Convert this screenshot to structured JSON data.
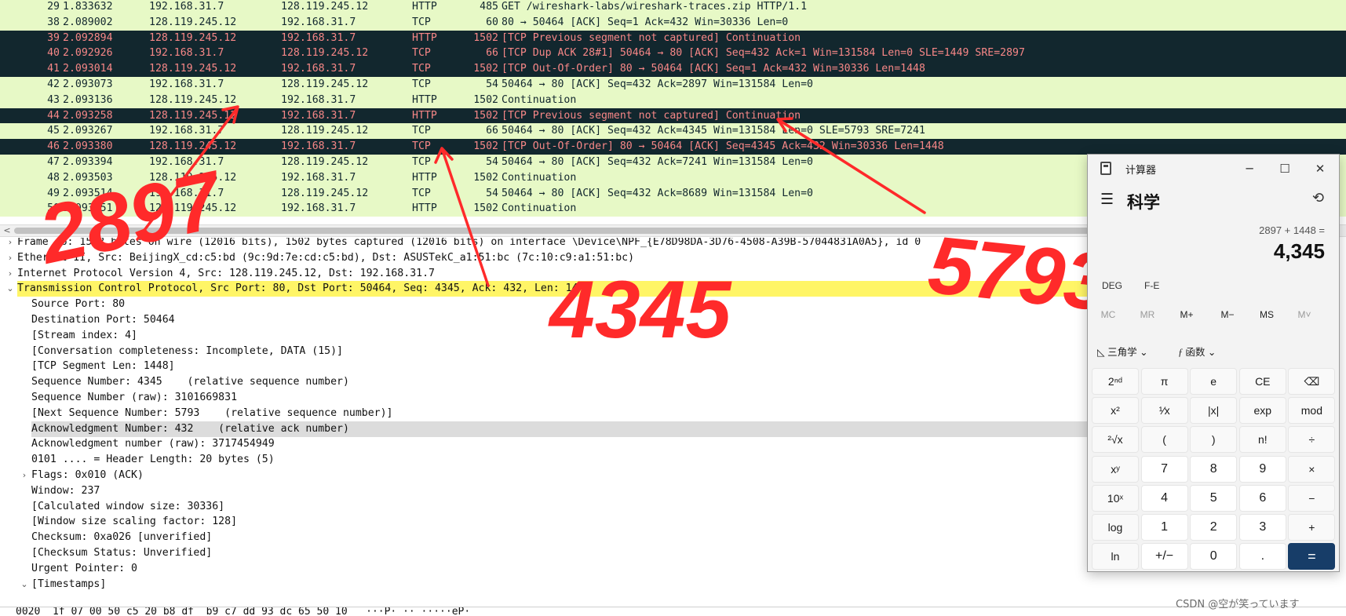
{
  "packets": [
    {
      "no": "29",
      "time": "1.833632",
      "src": "192.168.31.7",
      "dst": "128.119.245.12",
      "proto": "HTTP",
      "len": "485",
      "info": "GET /wireshark-labs/wireshark-traces.zip HTTP/1.1",
      "style": "light"
    },
    {
      "no": "38",
      "time": "2.089002",
      "src": "128.119.245.12",
      "dst": "192.168.31.7",
      "proto": "TCP",
      "len": "60",
      "info": "80 → 50464 [ACK] Seq=1 Ack=432 Win=30336 Len=0",
      "style": "light"
    },
    {
      "no": "39",
      "time": "2.092894",
      "src": "128.119.245.12",
      "dst": "192.168.31.7",
      "proto": "HTTP",
      "len": "1502",
      "info": "[TCP Previous segment not captured] Continuation",
      "style": "dark"
    },
    {
      "no": "40",
      "time": "2.092926",
      "src": "192.168.31.7",
      "dst": "128.119.245.12",
      "proto": "TCP",
      "len": "66",
      "info": "[TCP Dup ACK 28#1] 50464 → 80 [ACK] Seq=432 Ack=1 Win=131584 Len=0 SLE=1449 SRE=2897",
      "style": "dark"
    },
    {
      "no": "41",
      "time": "2.093014",
      "src": "128.119.245.12",
      "dst": "192.168.31.7",
      "proto": "TCP",
      "len": "1502",
      "info": "[TCP Out-Of-Order] 80 → 50464 [ACK] Seq=1 Ack=432 Win=30336 Len=1448",
      "style": "dark"
    },
    {
      "no": "42",
      "time": "2.093073",
      "src": "192.168.31.7",
      "dst": "128.119.245.12",
      "proto": "TCP",
      "len": "54",
      "info": "50464 → 80 [ACK] Seq=432 Ack=2897 Win=131584 Len=0",
      "style": "light"
    },
    {
      "no": "43",
      "time": "2.093136",
      "src": "128.119.245.12",
      "dst": "192.168.31.7",
      "proto": "HTTP",
      "len": "1502",
      "info": "Continuation",
      "style": "light"
    },
    {
      "no": "44",
      "time": "2.093258",
      "src": "128.119.245.12",
      "dst": "192.168.31.7",
      "proto": "HTTP",
      "len": "1502",
      "info": "[TCP Previous segment not captured] Continuation",
      "style": "dark"
    },
    {
      "no": "45",
      "time": "2.093267",
      "src": "192.168.31.7",
      "dst": "128.119.245.12",
      "proto": "TCP",
      "len": "66",
      "info": "50464 → 80 [ACK] Seq=432 Ack=4345 Win=131584 Len=0 SLE=5793 SRE=7241",
      "style": "light"
    },
    {
      "no": "46",
      "time": "2.093380",
      "src": "128.119.245.12",
      "dst": "192.168.31.7",
      "proto": "TCP",
      "len": "1502",
      "info": "[TCP Out-Of-Order] 80 → 50464 [ACK] Seq=4345 Ack=432 Win=30336 Len=1448",
      "style": "dark"
    },
    {
      "no": "47",
      "time": "2.093394",
      "src": "192.168.31.7",
      "dst": "128.119.245.12",
      "proto": "TCP",
      "len": "54",
      "info": "50464 → 80 [ACK] Seq=432 Ack=7241 Win=131584 Len=0",
      "style": "light"
    },
    {
      "no": "48",
      "time": "2.093503",
      "src": "128.119.245.12",
      "dst": "192.168.31.7",
      "proto": "HTTP",
      "len": "1502",
      "info": "Continuation",
      "style": "light"
    },
    {
      "no": "49",
      "time": "2.093514",
      "src": "192.168.31.7",
      "dst": "128.119.245.12",
      "proto": "TCP",
      "len": "54",
      "info": "50464 → 80 [ACK] Seq=432 Ack=8689 Win=131584 Len=0",
      "style": "light"
    },
    {
      "no": "50",
      "time": "2.093651",
      "src": "128.119.245.12",
      "dst": "192.168.31.7",
      "proto": "HTTP",
      "len": "1502",
      "info": "Continuation",
      "style": "light"
    }
  ],
  "details": [
    {
      "arrow": "›",
      "indent": 0,
      "text": "Frame 46: 1502 bytes on wire (12016 bits), 1502 bytes captured (12016 bits) on interface \\Device\\NPF_{E78D98DA-3D76-4508-A39B-57044831A0A5}, id 0",
      "style": ""
    },
    {
      "arrow": "›",
      "indent": 0,
      "text": "Ethernet II, Src: BeijingX_cd:c5:bd (9c:9d:7e:cd:c5:bd), Dst: ASUSTekC_a1:51:bc (7c:10:c9:a1:51:bc)",
      "style": ""
    },
    {
      "arrow": "›",
      "indent": 0,
      "text": "Internet Protocol Version 4, Src: 128.119.245.12, Dst: 192.168.31.7",
      "style": ""
    },
    {
      "arrow": "⌄",
      "indent": 0,
      "text": "Transmission Control Protocol, Src Port: 80, Dst Port: 50464, Seq: 4345, Ack: 432, Len: 1448",
      "style": "sel"
    },
    {
      "arrow": "",
      "indent": 1,
      "text": "Source Port: 80",
      "style": ""
    },
    {
      "arrow": "",
      "indent": 1,
      "text": "Destination Port: 50464",
      "style": ""
    },
    {
      "arrow": "",
      "indent": 1,
      "text": "[Stream index: 4]",
      "style": ""
    },
    {
      "arrow": "",
      "indent": 1,
      "text": "[Conversation completeness: Incomplete, DATA (15)]",
      "style": ""
    },
    {
      "arrow": "",
      "indent": 1,
      "text": "[TCP Segment Len: 1448]",
      "style": ""
    },
    {
      "arrow": "",
      "indent": 1,
      "text": "Sequence Number: 4345    (relative sequence number)",
      "style": ""
    },
    {
      "arrow": "",
      "indent": 1,
      "text": "Sequence Number (raw): 3101669831",
      "style": ""
    },
    {
      "arrow": "",
      "indent": 1,
      "text": "[Next Sequence Number: 5793    (relative sequence number)]",
      "style": ""
    },
    {
      "arrow": "",
      "indent": 1,
      "text": "Acknowledgment Number: 432    (relative ack number)",
      "style": "hl"
    },
    {
      "arrow": "",
      "indent": 1,
      "text": "Acknowledgment number (raw): 3717454949",
      "style": ""
    },
    {
      "arrow": "",
      "indent": 1,
      "text": "0101 .... = Header Length: 20 bytes (5)",
      "style": ""
    },
    {
      "arrow": "›",
      "indent": 1,
      "text": "Flags: 0x010 (ACK)",
      "style": ""
    },
    {
      "arrow": "",
      "indent": 1,
      "text": "Window: 237",
      "style": ""
    },
    {
      "arrow": "",
      "indent": 1,
      "text": "[Calculated window size: 30336]",
      "style": ""
    },
    {
      "arrow": "",
      "indent": 1,
      "text": "[Window size scaling factor: 128]",
      "style": ""
    },
    {
      "arrow": "",
      "indent": 1,
      "text": "Checksum: 0xa026 [unverified]",
      "style": ""
    },
    {
      "arrow": "",
      "indent": 1,
      "text": "[Checksum Status: Unverified]",
      "style": ""
    },
    {
      "arrow": "",
      "indent": 1,
      "text": "Urgent Pointer: 0",
      "style": ""
    },
    {
      "arrow": "⌄",
      "indent": 1,
      "text": "[Timestamps]",
      "style": ""
    }
  ],
  "bytes_line": "0020  1f 07 00 50 c5 20 b8 df  b9 c7 dd 93 dc 65 50 10   ···P· ·· ·····eP·",
  "annotations": {
    "n2897": "2897",
    "n4345": "4345",
    "n5793": "5793",
    "color": "#ff2a2a"
  },
  "calculator": {
    "title": "计算器",
    "mode": "科学",
    "expression": "2897 + 1448 =",
    "result": "4,345",
    "deg": "DEG",
    "fe": "F-E",
    "memory": [
      "MC",
      "MR",
      "M+",
      "M−",
      "MS",
      "M˅"
    ],
    "trig": "三角学",
    "func": "函数",
    "keys": [
      [
        "2ⁿᵈ",
        "π",
        "e",
        "CE",
        "⌫"
      ],
      [
        "x²",
        "¹⁄x",
        "|x|",
        "exp",
        "mod"
      ],
      [
        "²√x",
        "(",
        ")",
        "n!",
        "÷"
      ],
      [
        "xʸ",
        "7",
        "8",
        "9",
        "×"
      ],
      [
        "10ˣ",
        "4",
        "5",
        "6",
        "−"
      ],
      [
        "log",
        "1",
        "2",
        "3",
        "+"
      ],
      [
        "ln",
        "+/−",
        "0",
        ".",
        "="
      ]
    ]
  },
  "watermark": "CSDN @空が笑っています",
  "colors": {
    "row_light": "#e7f9c6",
    "row_dark": "#12272e",
    "row_dark_text": "#f78787",
    "selected": "#fff566",
    "equals_key": "#173d68"
  }
}
